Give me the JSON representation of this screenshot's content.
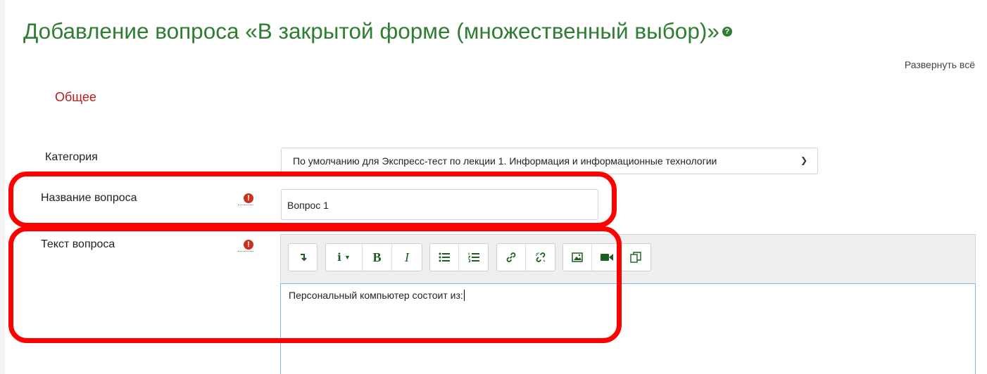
{
  "page": {
    "title": "Добавление вопроса «В закрытой форме (множественный выбор)»",
    "help_icon": "question-circle-icon",
    "expand_all": "Развернуть всё",
    "section_general": "Общее"
  },
  "form": {
    "category_label": "Категория",
    "category_value": "По умолчанию для Экспресс-тест по лекции 1. Информация и информационные технологии",
    "name_label": "Название вопроса",
    "name_value": "Вопрос 1",
    "text_label": "Текст вопроса",
    "text_value": "Персональный компьютер состоит из:",
    "required_icon": "exclamation-circle-icon"
  },
  "toolbar": {
    "buttons": [
      "expand-toolbar",
      "paragraph-style",
      "bold",
      "italic",
      "unordered-list",
      "ordered-list",
      "link",
      "unlink",
      "image",
      "media",
      "manage-files"
    ]
  },
  "colors": {
    "title_green": "#2e7d32",
    "section_red": "#b71c1c",
    "required_red": "#ca3120",
    "highlight_red": "#ff0000"
  }
}
